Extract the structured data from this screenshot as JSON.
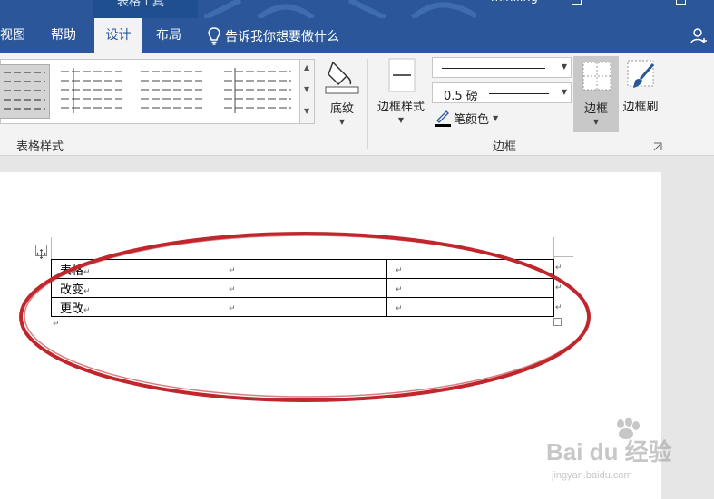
{
  "titlebar": {
    "tools_tab_label": "表格工具",
    "filename": "miniling"
  },
  "tabs": [
    {
      "label": "视图"
    },
    {
      "label": "帮助"
    },
    {
      "label": "设计"
    },
    {
      "label": "布局"
    }
  ],
  "tell_me": "告诉我你想要做什么",
  "ribbon": {
    "table_styles_group": "表格样式",
    "shading_label": "底纹",
    "border_styles_label": "边框样式",
    "weight_value": "0.5 磅",
    "pen_color_label": "笔颜色",
    "borders_label": "边框",
    "border_painter_label": "边框刷",
    "borders_group": "边框"
  },
  "document": {
    "table": {
      "rows": [
        [
          "表格",
          "",
          ""
        ],
        [
          "改变",
          "",
          ""
        ],
        [
          "更改",
          "",
          ""
        ]
      ]
    },
    "paragraph_mark": "↵"
  },
  "colors": {
    "title_blue": "#2b579a",
    "annotation_red": "#c0272d"
  },
  "watermark": {
    "brand": "Bai du 经验",
    "url": "jingyan.baidu.com"
  }
}
